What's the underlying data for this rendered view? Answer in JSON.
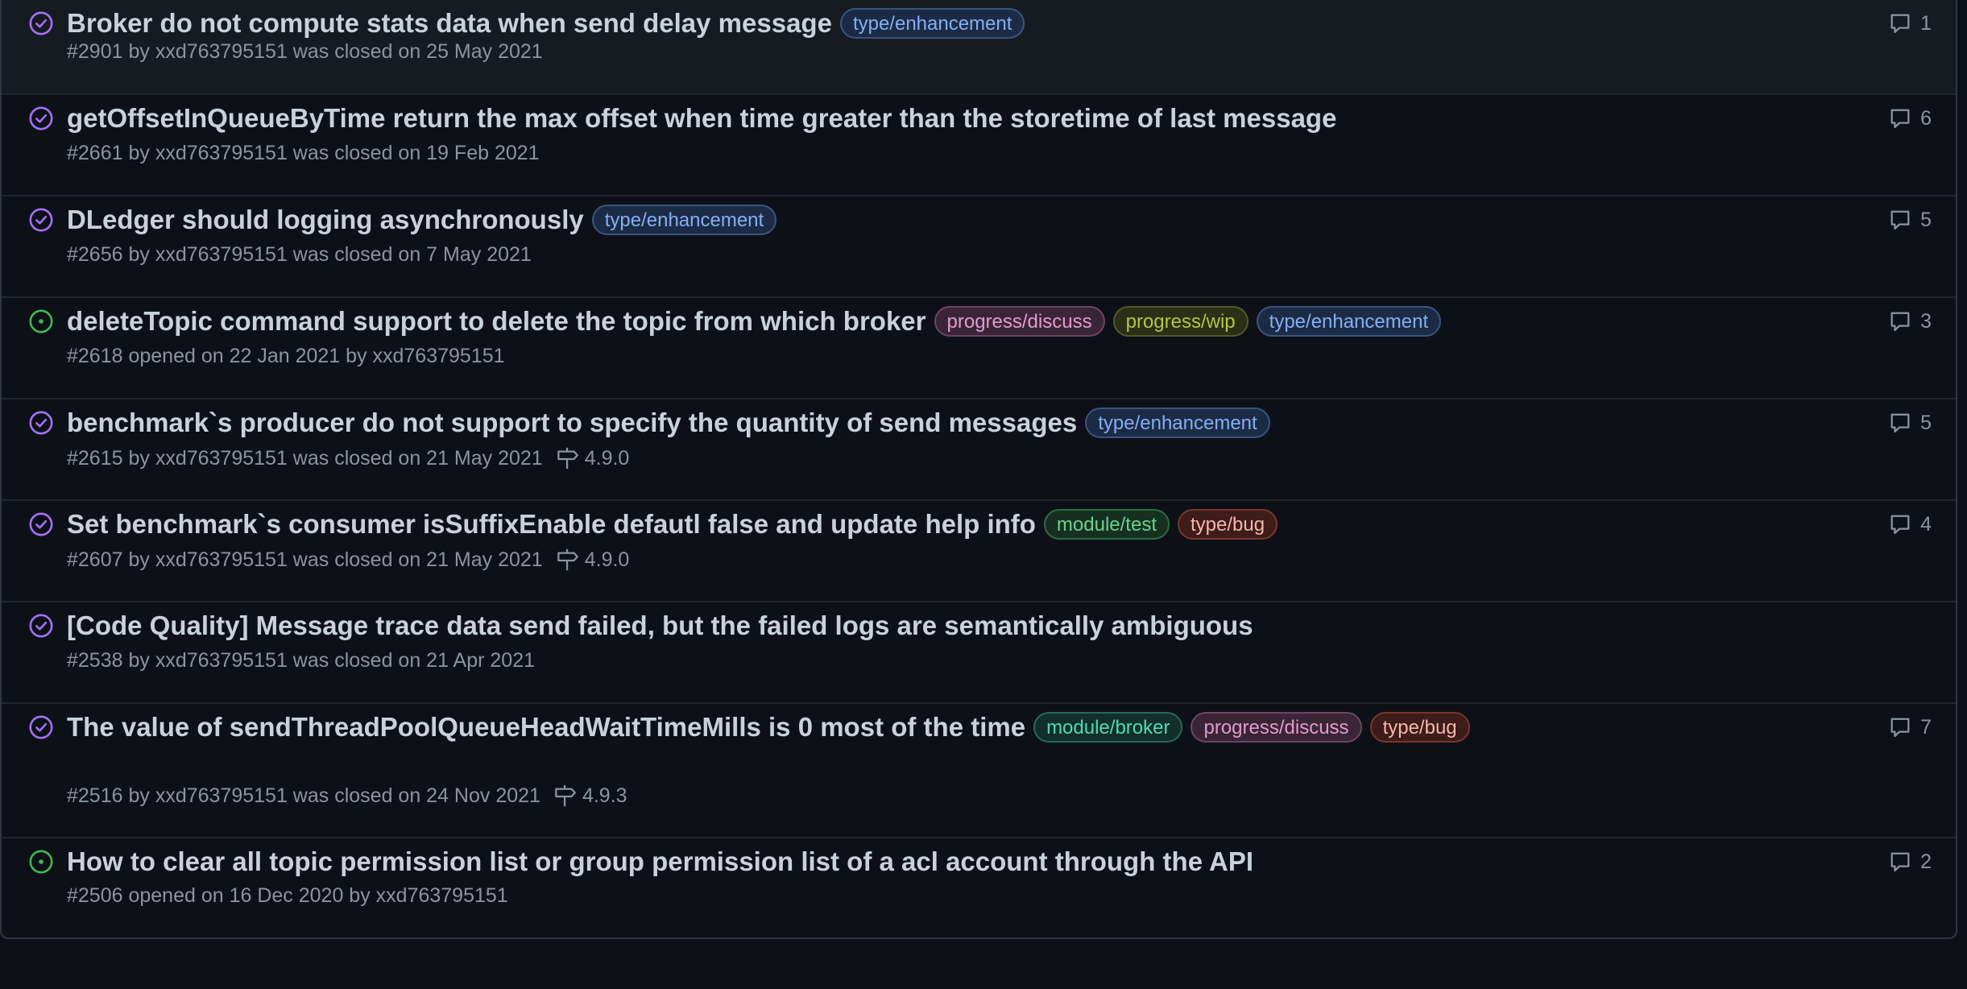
{
  "labels": {
    "type_enhancement": {
      "text": "type/enhancement",
      "color": "#84aef5",
      "bg": "#1c2b45",
      "border": "#3b5480"
    },
    "progress_discuss": {
      "text": "progress/discuss",
      "color": "#e39ad1",
      "bg": "#3a2536",
      "border": "#6d4462"
    },
    "progress_wip": {
      "text": "progress/wip",
      "color": "#b3c647",
      "bg": "#2a2f16",
      "border": "#52592a"
    },
    "module_test": {
      "text": "module/test",
      "color": "#68d38c",
      "bg": "#153020",
      "border": "#2c6b41"
    },
    "type_bug": {
      "text": "type/bug",
      "color": "#f5b6ac",
      "bg": "#3e1c19",
      "border": "#7a342c"
    },
    "module_broker": {
      "text": "module/broker",
      "color": "#4fd9b8",
      "bg": "#123029",
      "border": "#236b5a"
    }
  },
  "colors": {
    "closed_icon": "#a371f7",
    "open_icon": "#3fb950",
    "title": "#c9d1d9",
    "meta": "#8b949e"
  },
  "issues": [
    {
      "state": "closed",
      "title": "Broker do not compute stats data when send delay message",
      "labels": [
        "type/enhancement"
      ],
      "meta": "#2901 by xxd763795151 was closed on 25 May 2021",
      "milestone": "",
      "comments": "1"
    },
    {
      "state": "closed",
      "title": "getOffsetInQueueByTime return the max offset when time greater than the storetime of last message",
      "labels": [],
      "meta": "#2661 by xxd763795151 was closed on 19 Feb 2021",
      "milestone": "",
      "comments": "6"
    },
    {
      "state": "closed",
      "title": "DLedger should logging asynchronously",
      "labels": [
        "type/enhancement"
      ],
      "meta": "#2656 by xxd763795151 was closed on 7 May 2021",
      "milestone": "",
      "comments": "5"
    },
    {
      "state": "open",
      "title": "deleteTopic command support to delete the topic from which broker",
      "labels": [
        "progress/discuss",
        "progress/wip",
        "type/enhancement"
      ],
      "meta": "#2618 opened on 22 Jan 2021 by xxd763795151",
      "milestone": "",
      "comments": "3"
    },
    {
      "state": "closed",
      "title": "benchmark`s producer do not support to specify the quantity of send messages",
      "labels": [
        "type/enhancement"
      ],
      "meta": "#2615 by xxd763795151 was closed on 21 May 2021",
      "milestone": "4.9.0",
      "comments": "5"
    },
    {
      "state": "closed",
      "title": "Set benchmark`s consumer isSuffixEnable defautl false and update help info",
      "labels": [
        "module/test",
        "type/bug"
      ],
      "meta": "#2607 by xxd763795151 was closed on 21 May 2021",
      "milestone": "4.9.0",
      "comments": "4"
    },
    {
      "state": "closed",
      "title": "[Code Quality] Message trace data send failed, but the failed logs are semantically ambiguous",
      "labels": [],
      "meta": "#2538 by xxd763795151 was closed on 21 Apr 2021",
      "milestone": "",
      "comments": ""
    },
    {
      "state": "closed",
      "title": "The value of sendThreadPoolQueueHeadWaitTimeMills is 0 most of the time",
      "labels": [
        "module/broker",
        "progress/discuss",
        "type/bug"
      ],
      "meta": "#2516 by xxd763795151 was closed on 24 Nov 2021",
      "milestone": "4.9.3",
      "comments": "7"
    },
    {
      "state": "open",
      "title": "How to clear all topic permission list or group permission list of a acl account through the API",
      "labels": [],
      "meta": "#2506 opened on 16 Dec 2020 by xxd763795151",
      "milestone": "",
      "comments": "2"
    }
  ]
}
